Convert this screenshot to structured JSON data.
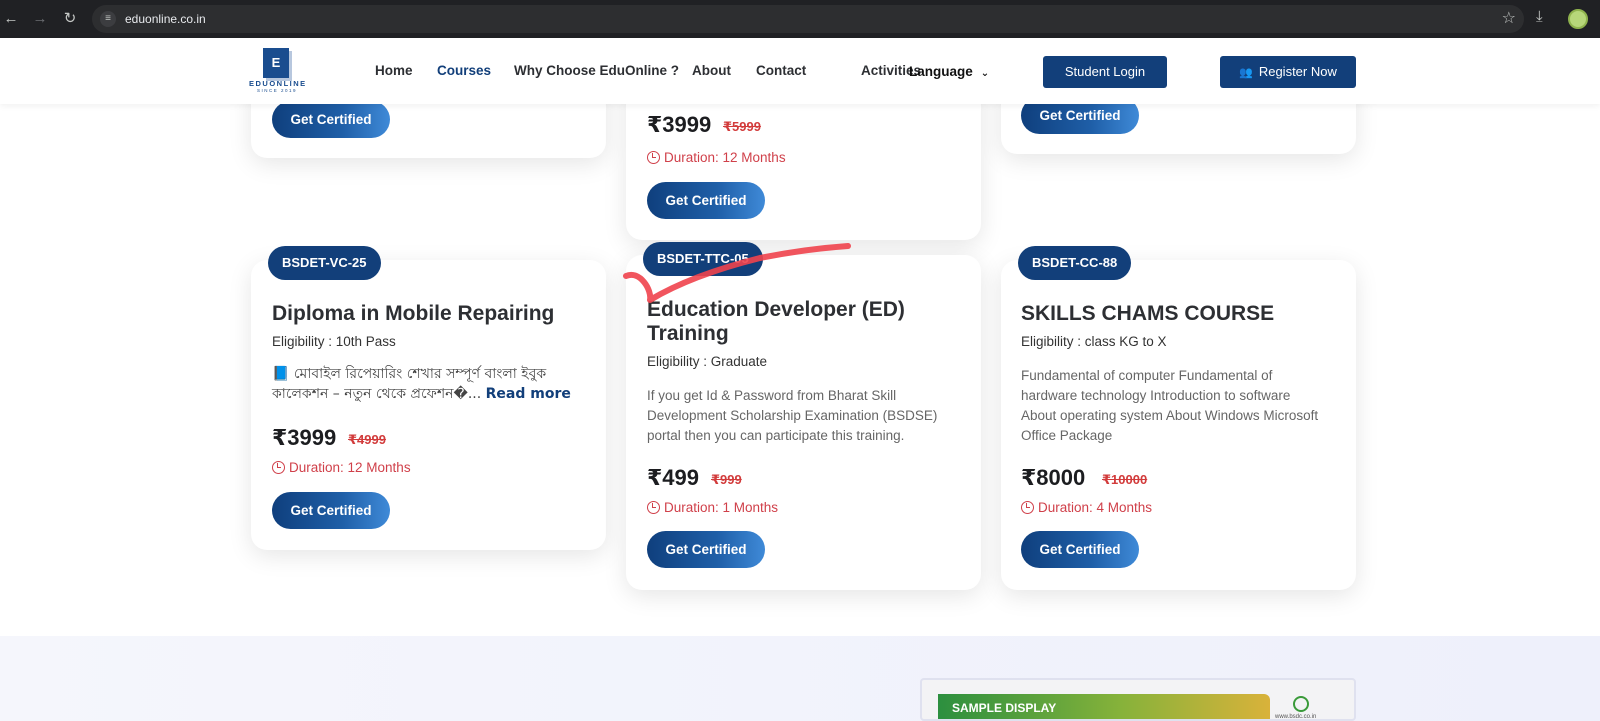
{
  "browser": {
    "url": "eduonline.co.in"
  },
  "header": {
    "logo_letter": "E",
    "logo_name": "EDUONLINE",
    "logo_since": "SINCE 2019",
    "nav": [
      {
        "label": "Home"
      },
      {
        "label": "Courses"
      },
      {
        "label": "Why Choose EduOnline ?"
      },
      {
        "label": "About"
      },
      {
        "label": "Contact"
      },
      {
        "label": "Activities"
      }
    ],
    "language_label": "Language",
    "student_login": "Student Login",
    "register_now": "Register Now"
  },
  "top_cards": [
    {
      "button": "Get Certified"
    },
    {
      "price": "₹3999",
      "old_price": "₹5999",
      "duration": "Duration: 12 Months",
      "button": "Get Certified"
    },
    {
      "button": "Get Certified"
    }
  ],
  "cards": [
    {
      "code": "BSDET-VC-25",
      "title": "Diploma in Mobile Repairing",
      "eligibility": "Eligibility : 10th Pass",
      "desc": "📘 মোবাইল রিপেয়ারিং শেখার সম্পূর্ণ বাংলা ইবুক কালেকশন – নতুন থেকে প্রফেশন�...",
      "read_more": "Read more",
      "price": "₹3999",
      "old_price": "₹4999",
      "duration": "Duration: 12 Months",
      "button": "Get Certified"
    },
    {
      "code": "BSDET-TTC-05",
      "title": "Education Developer (ED) Training",
      "eligibility": "Eligibility : Graduate",
      "desc": "If you get Id & Password from Bharat Skill Development Scholarship Examination (BSDSE) portal then you can participate this training.",
      "price": "₹499",
      "old_price": "₹999",
      "duration": "Duration: 1 Months",
      "button": "Get Certified"
    },
    {
      "code": "BSDET-CC-88",
      "title": "SKILLS CHAMS COURSE",
      "eligibility": "Eligibility : class KG to X",
      "desc": "Fundamental of computer Fundamental of hardware technology Introduction to software About operating system About Windows Microsoft Office Package",
      "price": "₹8000",
      "old_price": "₹10000",
      "duration": "Duration: 4 Months",
      "button": "Get Certified"
    }
  ],
  "sample": {
    "label": "SAMPLE DISPLAY",
    "site": "www.bsdc.co.in"
  },
  "colors": {
    "brand": "#123f7a",
    "duration": "#d0404a",
    "annotation": "#f0424c"
  }
}
